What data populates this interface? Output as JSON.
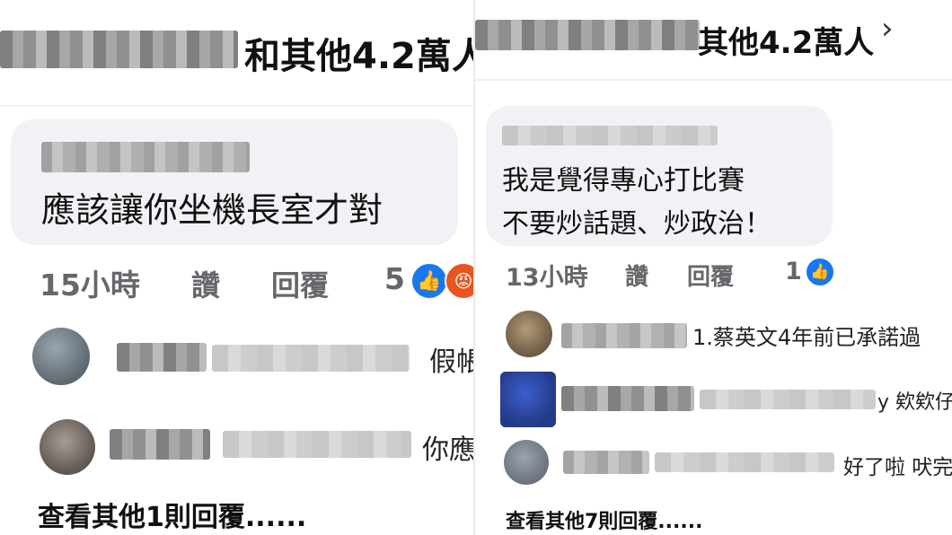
{
  "left": {
    "header_text": "和其他4.2萬人",
    "comment": {
      "text": "應該讓你坐機長室才對"
    },
    "meta": {
      "time": "15小時",
      "like": "讚",
      "reply": "回覆",
      "reaction_count": "5"
    },
    "replies": [
      {
        "text": "假帳"
      },
      {
        "text": "你應"
      }
    ],
    "more_replies": "查看其他1則回覆......"
  },
  "right": {
    "header_text": "其他4.2萬人",
    "chevron": "›",
    "comment": {
      "line1": "我是覺得專心打比賽",
      "line2": "不要炒話題、炒政治！"
    },
    "meta": {
      "time": "13小時",
      "like": "讚",
      "reply": "回覆",
      "reaction_count": "1"
    },
    "replies": [
      {
        "text": "1.蔡英文4年前已承諾過"
      },
      {
        "text": "y 欸欸仔"
      },
      {
        "text": "好了啦 吠完"
      }
    ],
    "more_replies": "查看其他7則回覆......"
  },
  "icons": {
    "like": "like-icon",
    "angry": "angry-reaction-icon",
    "chevron": "chevron-right-icon"
  },
  "colors": {
    "like_blue": "#1877f2",
    "angry_orange": "#e9541f",
    "bubble_bg": "#f0f2f5",
    "meta_gray": "#65676b"
  }
}
